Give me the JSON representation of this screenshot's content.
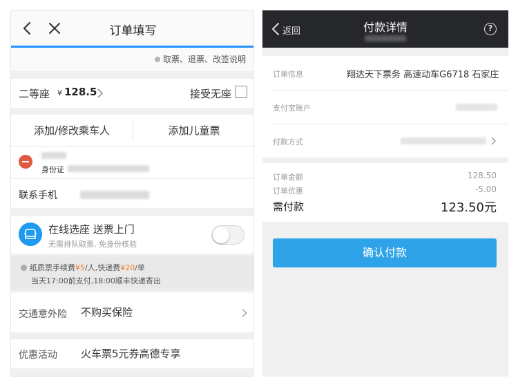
{
  "left": {
    "header": {
      "title": "订单填写"
    },
    "info_link": "取票、退票、改签说明",
    "seat": {
      "type": "二等座",
      "currency": "¥",
      "price": "128.5",
      "no_seat_label": "接受无座"
    },
    "passengers": {
      "add_button": "添加/修改乘车人",
      "child_button": "添加儿童票",
      "id_label": "身份证",
      "phone_label": "联系手机"
    },
    "seat_select": {
      "title": "在线选座 送票上门",
      "subtitle": "无需排队取票, 免身份核验",
      "enabled": false
    },
    "fee_notice": {
      "prefix": "纸质票手续费",
      "fee": "¥5",
      "per": "/人,快递费",
      "delivery": "¥20",
      "suffix": "/单",
      "line2": "当天17:00前支付,18:00顺丰快递寄出"
    },
    "insurance": {
      "label": "交通意外险",
      "value": "不购买保险"
    },
    "promo": {
      "label": "优惠活动",
      "value": "火车票5元券高德专享"
    }
  },
  "right": {
    "header": {
      "back_label": "返回",
      "title": "付款详情"
    },
    "order": {
      "info_label": "订单信息",
      "info_value": "翔达天下票务 高速动车G6718 石家庄",
      "account_label": "支付宝账户",
      "method_label": "付款方式"
    },
    "summary": {
      "amount_label": "订单金额",
      "amount_value": "128.50",
      "discount_label": "订单优惠",
      "discount_value": "-5.00",
      "due_label": "需付款",
      "due_value": "123.50元"
    },
    "confirm_button": "确认付款"
  },
  "colors": {
    "accent": "#1e90ff",
    "pay_button": "#2ea3e8",
    "fee_highlight": "#ee7a22",
    "danger": "#e15841"
  }
}
